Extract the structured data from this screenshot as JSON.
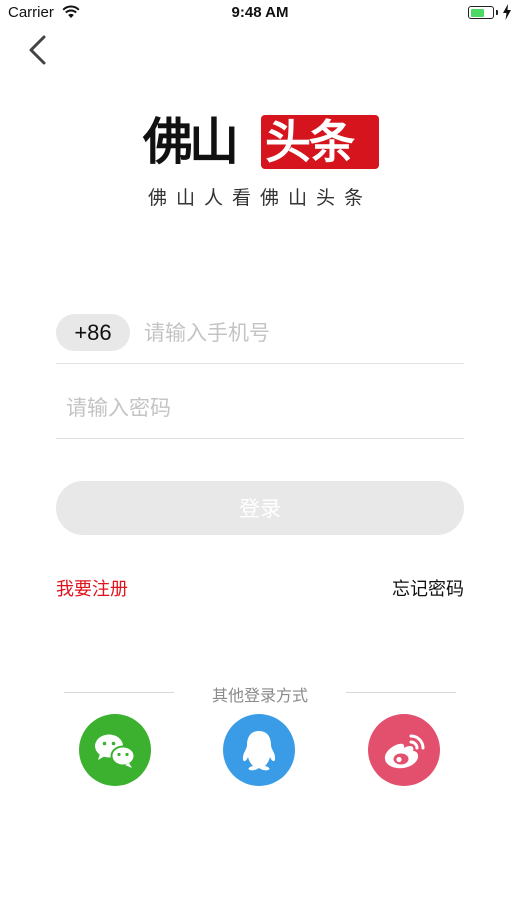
{
  "status_bar": {
    "carrier": "Carrier",
    "time": "9:48 AM"
  },
  "logo": {
    "left_text": "佛山",
    "right_text": "头条",
    "brand_red": "#d6141e",
    "slogan": "佛山人看佛山头条"
  },
  "form": {
    "country_code": "+86",
    "phone_placeholder": "请输入手机号",
    "password_placeholder": "请输入密码",
    "login_label": "登录"
  },
  "links": {
    "register": "我要注册",
    "forgot_password": "忘记密码"
  },
  "other_login": {
    "label": "其他登录方式",
    "providers": [
      {
        "icon": "wechat-icon",
        "color": "#3bb12f"
      },
      {
        "icon": "qq-icon",
        "color": "#3a9ce6"
      },
      {
        "icon": "weibo-icon",
        "color": "#e2506e"
      }
    ]
  }
}
